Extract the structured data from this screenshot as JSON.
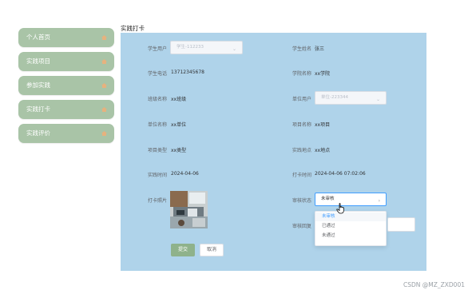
{
  "sidebar": {
    "items": [
      {
        "label": "个人首页"
      },
      {
        "label": "实践项目"
      },
      {
        "label": "参加实践"
      },
      {
        "label": "实践打卡"
      },
      {
        "label": "实践评价"
      }
    ]
  },
  "page_title": "实践打卡",
  "form": {
    "student_user_label": "学生用户",
    "student_user_value": "学生-112233",
    "student_name_label": "学生姓名",
    "student_name_value": "张三",
    "student_phone_label": "学生电话",
    "student_phone_value": "13712345678",
    "college_label": "学院名称",
    "college_value": "xx学院",
    "class_label": "班级名称",
    "class_value": "xx班级",
    "unit_user_label": "单位用户",
    "unit_user_value": "单位-223344",
    "unit_name_label": "单位名称",
    "unit_name_value": "xx单位",
    "project_name_label": "项目名称",
    "project_name_value": "xx项目",
    "project_type_label": "项目类型",
    "project_type_value": "xx类型",
    "location_label": "实践地点",
    "location_value": "xx地点",
    "practice_time_label": "实践时间",
    "practice_time_value": "2024-04-06",
    "checkin_time_label": "打卡时间",
    "checkin_time_value": "2024-04-06 07:02:06",
    "photo_label": "打卡照片",
    "review_status_label": "审核状态",
    "review_status_value": "未审核",
    "review_reply_label": "审核回复"
  },
  "review_options": [
    "未审核",
    "已通过",
    "未通过"
  ],
  "buttons": {
    "submit": "提交",
    "cancel": "取消"
  },
  "watermark": "CSDN @MZ_ZXD001",
  "colors": {
    "sidebar": "#a9c4a7",
    "panel": "#afd3ea",
    "submit": "#8fb28b",
    "selected_option": "#409eff"
  }
}
